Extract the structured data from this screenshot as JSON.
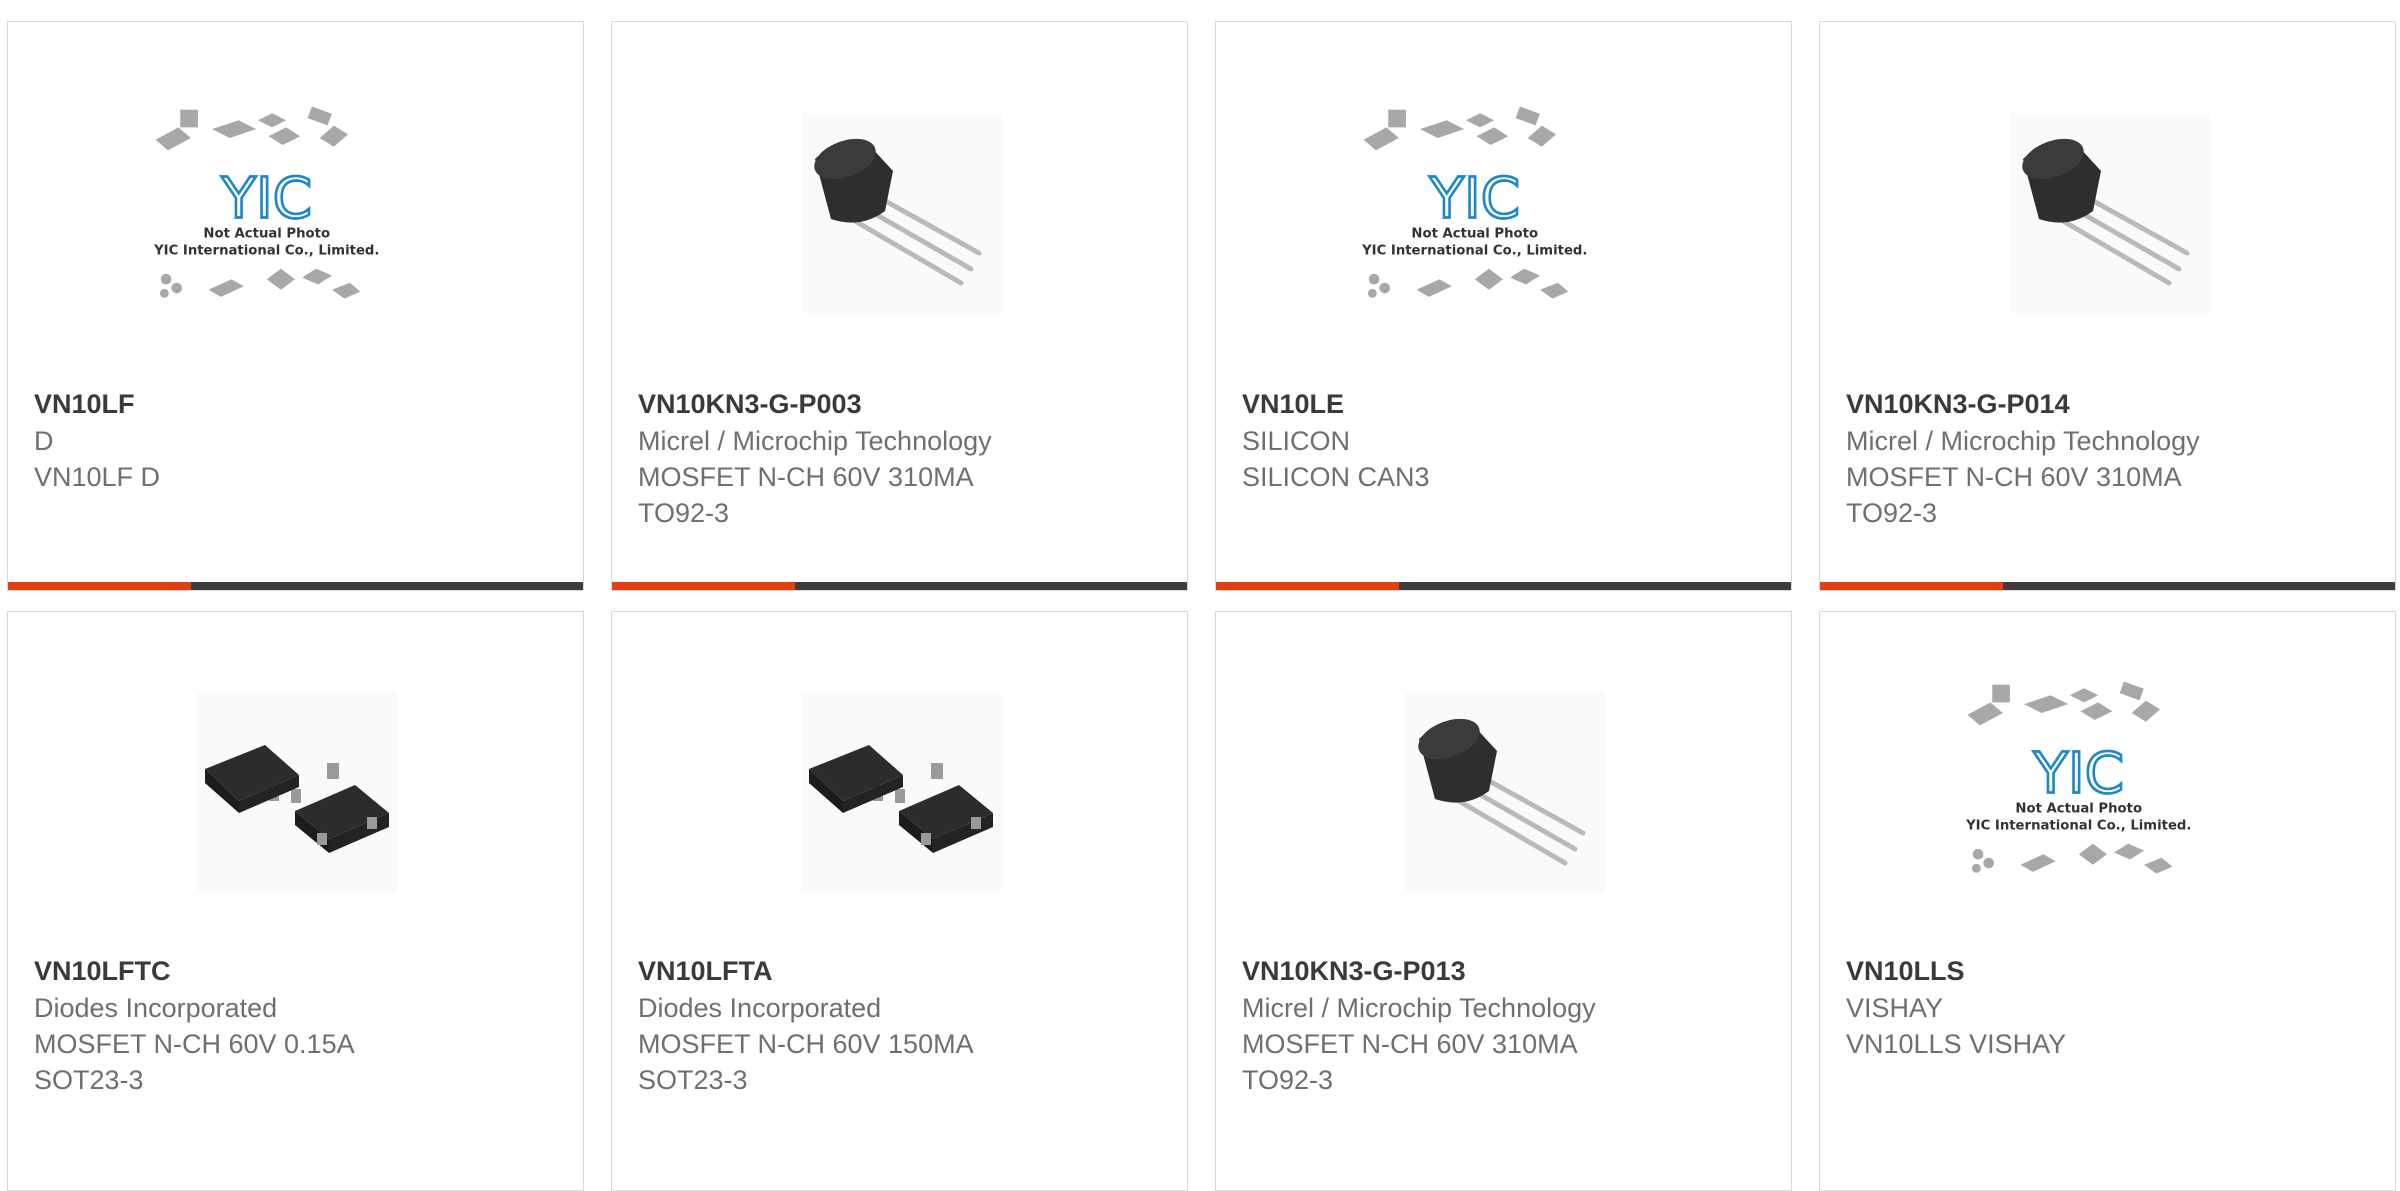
{
  "colors": {
    "accent": "#e43f12",
    "bar": "#3d3d3d",
    "brand_blue": "#1e88c9"
  },
  "placeholder": {
    "line1": "Not Actual Photo",
    "line2": "YIC International Co., Limited.",
    "logo": "YIC"
  },
  "cards": [
    {
      "part": "VN10LF",
      "lines": [
        "D",
        "VN10LF D",
        ""
      ],
      "image": "placeholder-logo"
    },
    {
      "part": "VN10KN3-G-P003",
      "lines": [
        "Micrel / Microchip Technology",
        "MOSFET N-CH 60V 310MA",
        "TO92-3"
      ],
      "image": "to92-transistor"
    },
    {
      "part": "VN10LE",
      "lines": [
        "SILICON",
        "SILICON CAN3",
        ""
      ],
      "image": "placeholder-logo"
    },
    {
      "part": "VN10KN3-G-P014",
      "lines": [
        "Micrel / Microchip Technology",
        "MOSFET N-CH 60V 310MA",
        "TO92-3"
      ],
      "image": "to92-transistor"
    },
    {
      "part": "VN10LFTC",
      "lines": [
        "Diodes Incorporated",
        "MOSFET N-CH 60V 0.15A",
        "SOT23-3"
      ],
      "image": "sot23-package"
    },
    {
      "part": "VN10LFTA",
      "lines": [
        "Diodes Incorporated",
        "MOSFET N-CH 60V 150MA",
        "SOT23-3"
      ],
      "image": "sot23-package"
    },
    {
      "part": "VN10KN3-G-P013",
      "lines": [
        "Micrel / Microchip Technology",
        "MOSFET N-CH 60V 310MA",
        "TO92-3"
      ],
      "image": "to92-transistor"
    },
    {
      "part": "VN10LLS",
      "lines": [
        "VISHAY",
        "VN10LLS VISHAY",
        ""
      ],
      "image": "placeholder-logo"
    }
  ]
}
